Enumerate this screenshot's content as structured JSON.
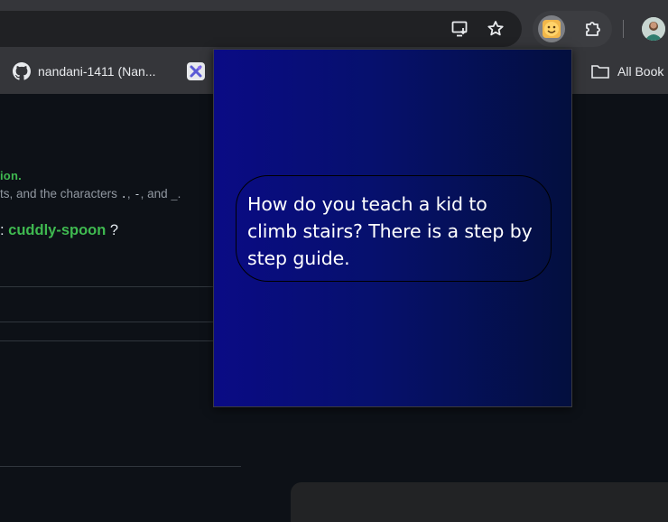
{
  "toolbar": {
    "icons": [
      "install-app-icon",
      "bookmark-star-icon",
      "extension-smiley-icon",
      "extensions-puzzle-icon",
      "profile-avatar"
    ]
  },
  "bookmarks": {
    "items": [
      {
        "label": "nandani-1411 (Nan...",
        "icon": "github-icon"
      },
      {
        "label": "",
        "icon": "app-icon"
      }
    ],
    "all_bookmarks_label": "All Book"
  },
  "page": {
    "green_text": "ion.",
    "hint_prefix": "ts, and the characters ",
    "hint_char_1": ".",
    "hint_sep_1": ", ",
    "hint_char_2": "-",
    "hint_sep_2": ", and ",
    "hint_char_3": "_",
    "hint_suffix": ".",
    "question_prefix": ": ",
    "repo_name": "cuddly-spoon",
    "question_suffix": " ?"
  },
  "popup": {
    "joke": "How do you teach a kid to climb stairs? There is a step by step guide.",
    "colors": {
      "gradient_left": "#0a0b85",
      "gradient_right": "#030f3e",
      "text": "#ffffff"
    }
  },
  "colors": {
    "accent_green": "#3fb950",
    "page_bg": "#0d1117",
    "chrome_bg": "#35363a"
  }
}
